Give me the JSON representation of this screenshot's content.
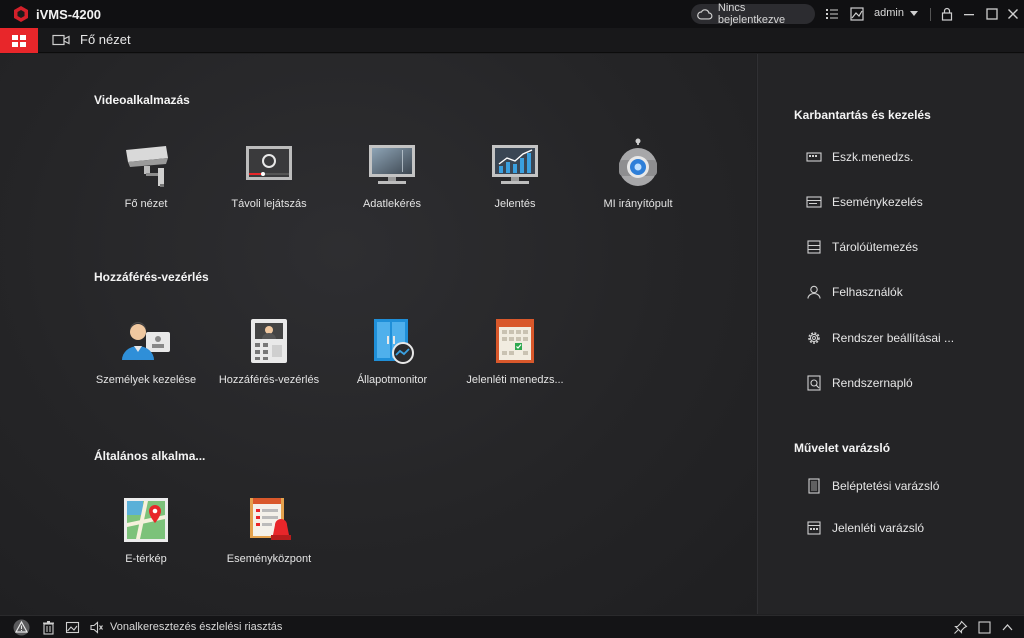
{
  "app": {
    "title": "iVMS-4200"
  },
  "titlebar": {
    "cloud_status": "Nincs bejelentkezve",
    "user": "admin",
    "icons": [
      "cloud-icon",
      "list-icon",
      "image-icon",
      "lock-icon",
      "minimize-icon",
      "maximize-icon",
      "close-icon"
    ]
  },
  "tabs": {
    "main_tab": "Fő nézet"
  },
  "sections": {
    "video": {
      "title": "Videoalkalmazás",
      "apps": [
        {
          "label": "Fő nézet",
          "icon": "camera-icon"
        },
        {
          "label": "Távoli lejátszás",
          "icon": "playback-icon"
        },
        {
          "label": "Adatlekérés",
          "icon": "monitor-icon"
        },
        {
          "label": "Jelentés",
          "icon": "report-chart-icon"
        },
        {
          "label": "MI irányítópult",
          "icon": "robot-icon"
        }
      ]
    },
    "access": {
      "title": "Hozzáférés-vezérlés",
      "apps": [
        {
          "label": "Személyek kezelése",
          "icon": "person-card-icon"
        },
        {
          "label": "Hozzáférés-vezérlés",
          "icon": "intercom-icon"
        },
        {
          "label": "Állapotmonitor",
          "icon": "door-monitor-icon"
        },
        {
          "label": "Jelenléti menedzs...",
          "icon": "calendar-icon"
        }
      ]
    },
    "general": {
      "title": "Általános alkalma...",
      "apps": [
        {
          "label": "E-térkép",
          "icon": "map-icon"
        },
        {
          "label": "Eseményközpont",
          "icon": "event-center-icon"
        }
      ]
    }
  },
  "right_panel": {
    "maintenance": {
      "title": "Karbantartás és kezelés",
      "items": [
        {
          "label": "Eszk.menedzs.",
          "icon": "device-icon"
        },
        {
          "label": "Eseménykezelés",
          "icon": "event-icon"
        },
        {
          "label": "Tárolóütemezés",
          "icon": "storage-icon"
        },
        {
          "label": "Felhasználók",
          "icon": "user-icon"
        },
        {
          "label": "Rendszer beállításai ...",
          "icon": "gear-icon"
        },
        {
          "label": "Rendszernapló",
          "icon": "log-icon"
        }
      ]
    },
    "wizard": {
      "title": "Művelet varázsló",
      "items": [
        {
          "label": "Beléptetési varázsló",
          "icon": "door-wizard-icon"
        },
        {
          "label": "Jelenléti varázsló",
          "icon": "attendance-wizard-icon"
        }
      ]
    }
  },
  "statusbar": {
    "alarm_text": "Vonalkeresztezés észlelési riasztás"
  },
  "colors": {
    "accent": "#e8262a",
    "background": "#202022",
    "panel": "#242426"
  }
}
